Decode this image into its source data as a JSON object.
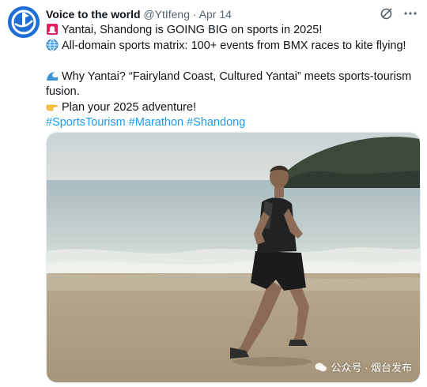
{
  "author": {
    "display_name": "Voice to the world",
    "handle": "@YtIfeng",
    "separator": "·",
    "date": "Apr 14",
    "avatar_icon": "voice-to-the-world-logo",
    "brand_color": "#1d6fd6"
  },
  "actions": {
    "grok_icon": "grok-icon",
    "more_icon": "more-icon"
  },
  "tweet": {
    "line1": "Yantai, Shandong is GOING BIG on sports in 2025!",
    "line1_emoji": "red-siren-emoji",
    "line2": "All-domain sports matrix: 100+ events from BMX races to kite flying!",
    "line2_emoji": "globe-emoji",
    "line3": "Why Yantai? “Fairyland Coast, Cultured Yantai” meets sports-tourism fusion.",
    "line3_emoji": "water-wave-emoji",
    "line4": "Plan your 2025 adventure!",
    "line4_emoji": "pointing-hand-emoji",
    "hashtags": [
      "#SportsTourism",
      "#Marathon",
      "#Shandong"
    ],
    "hashtag_color": "#1d9bf0"
  },
  "media": {
    "image": "man-running-on-beach-photo",
    "watermark": "公众号 · 烟台发布",
    "watermark_icon": "wechat-icon"
  }
}
